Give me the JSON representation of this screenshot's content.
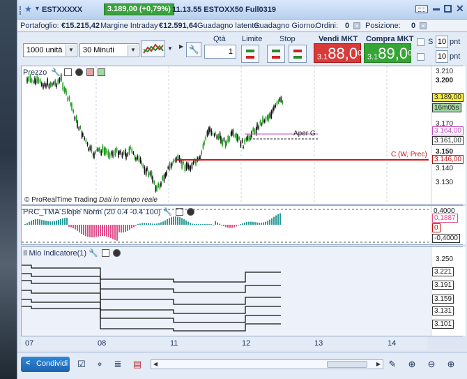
{
  "window": {
    "symbol": "ESTXXXXX",
    "price_badge": "3.189,00 (+0,79%)",
    "time_info": "11.13.55 ESTOXX50 Full0319"
  },
  "info": {
    "portfolio_label": "Portafoglio:",
    "portfolio_value": "€15.215,42",
    "margin_label": "Margine Intraday",
    "margin_value": "€12.591,64",
    "gain_label": "Guadagno latente:",
    "gain_value": "-",
    "orders_label": "Guadagno Giorno:",
    "orders2_label": "-Ordini:",
    "orders_value": "0",
    "position_label": "Posizione:",
    "position_value": "0"
  },
  "toolbar": {
    "units_value": "1000 unità",
    "interval_value": "30 Minuti",
    "qty_label": "Qtà",
    "qty_value": "1",
    "limit_label": "Limite",
    "stop_label": "Stop",
    "sell_label": "Vendi MKT",
    "sell_price_prefix": "3.1",
    "sell_price_big": "88,0",
    "sell_price_sup": "0",
    "buy_label": "Compra MKT",
    "buy_price_prefix": "3.1",
    "buy_price_big": "89,0",
    "buy_price_sup": "0",
    "s_label": "S",
    "s_value": "10",
    "s_unit": "pnt",
    "l_value": "10",
    "l_unit": "pnt"
  },
  "price_panel": {
    "title": "Prezzo",
    "copyright": "© ProRealTime Trading",
    "realtime": "Dati in tempo reale",
    "aper_label": "Aper G",
    "close_label": "C (W, Prec)",
    "ticks": [
      "3.210",
      "3.200",
      "3.170",
      "3.150",
      "3.140",
      "3.130"
    ],
    "tag_last": "3.189,00",
    "tag_countdown": "16m05s",
    "tag_open": "3.164,00",
    "tag_dashed": "3.161,00",
    "tag_close": "3.146,00"
  },
  "slope_panel": {
    "title": "PRC_TMA Slope Norm (20 0.4 -0.4 100)",
    "tag_top": "0,4000",
    "tag_value": "0,1887",
    "tag_zero": "0",
    "tag_bottom": "-0,4000"
  },
  "indicator_panel": {
    "title": "Il Mio Indicatore(1)",
    "ticks": [
      "3.250",
      "3.221",
      "3.191",
      "3.159",
      "3.131",
      "3.101"
    ]
  },
  "xaxis": [
    "07",
    "08",
    "11",
    "12",
    "13",
    "14"
  ],
  "bottom": {
    "share_label": "Condividi"
  },
  "colors": {
    "up": "#1f9a1f",
    "down": "#111111",
    "close_line": "#e01010",
    "open_line": "#c24bc2",
    "slope_pos": "#2a9a9a",
    "slope_neg": "#e0508a"
  }
}
